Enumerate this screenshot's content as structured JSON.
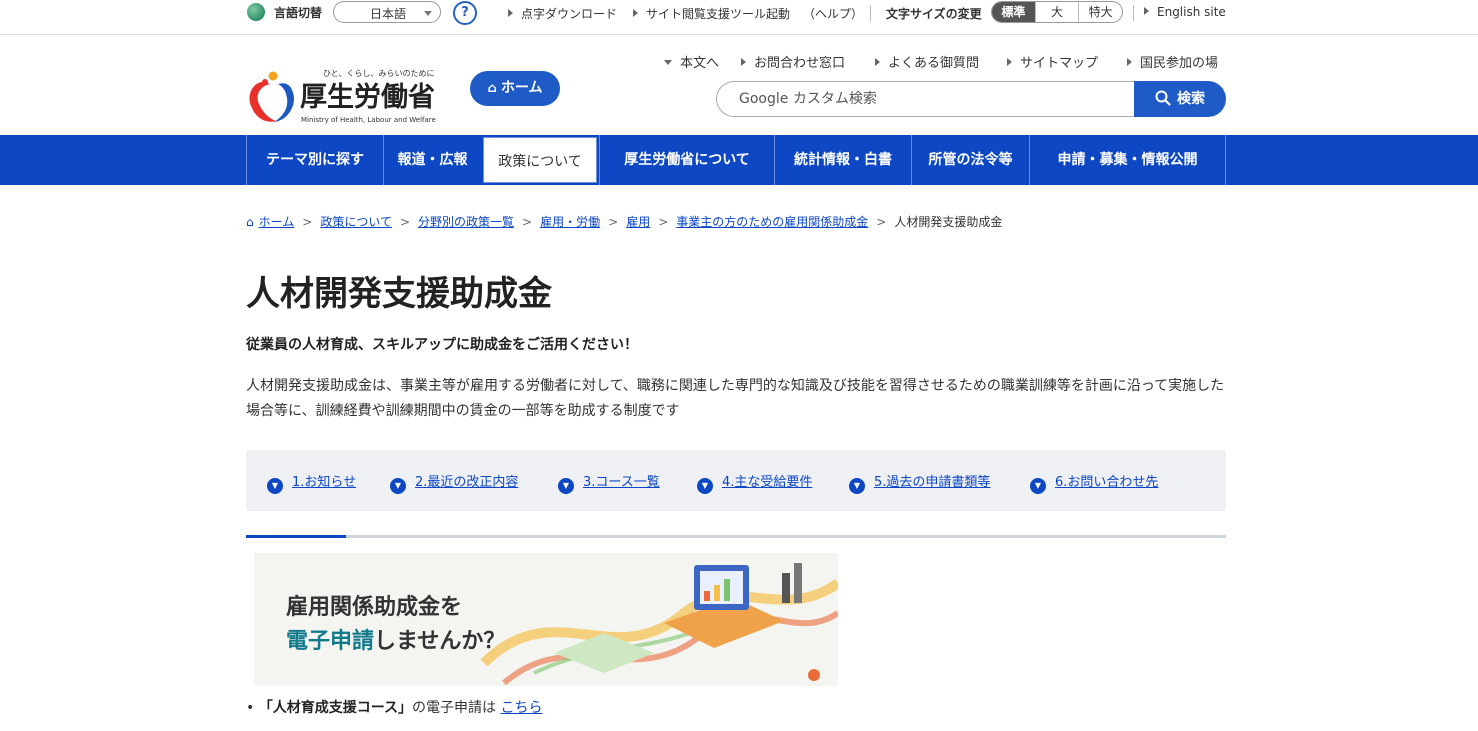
{
  "utility": {
    "lang_label": "言語切替",
    "lang_value": "日本語",
    "help": "?",
    "braille": "点字ダウンロード",
    "reading_tool": "サイト閲覧支援ツール起動",
    "reading_help": "（ヘルプ）",
    "font_size_label": "文字サイズの変更",
    "font_sizes": [
      "標準",
      "大",
      "特大"
    ],
    "english": "English site"
  },
  "header": {
    "logo_tagline": "ひと、くらし、みらいのために",
    "logo_name": "厚生労働省",
    "logo_english": "Ministry of Health, Labour and Welfare",
    "home_button": "ホーム",
    "links": [
      "本文へ",
      "お問合わせ窓口",
      "よくある御質問",
      "サイトマップ",
      "国民参加の場"
    ],
    "search_placeholder": "Google カスタム検索",
    "search_button": "検索"
  },
  "nav": [
    "テーマ別に探す",
    "報道・広報",
    "政策について",
    "厚生労働省について",
    "統計情報・白書",
    "所管の法令等",
    "申請・募集・情報公開"
  ],
  "breadcrumb": [
    "ホーム",
    "政策について",
    "分野別の政策一覧",
    "雇用・労働",
    "雇用",
    "事業主の方のための雇用関係助成金",
    "人材開発支援助成金"
  ],
  "page": {
    "title": "人材開発支援助成金",
    "lead": "従業員の人材育成、スキルアップに助成金をご活用ください！",
    "description": "人材開発支援助成金は、事業主等が雇用する労働者に対して、職務に関連した専門的な知識及び技能を習得させるための職業訓練等を計画に沿って実施した場合等に、訓練経費や訓練期間中の賃金の一部等を助成する制度です",
    "anchors": [
      "1.お知らせ",
      "2.最近の改正内容",
      "3.コース一覧",
      "4.主な受給要件",
      "5.過去の申請書類等",
      "6.お問い合わせ先"
    ],
    "banner_line1": "雇用関係助成金を",
    "banner_line2_highlight": "電子申請",
    "banner_line2_rest": "しませんか？",
    "bullet_bold": "「人材育成支援コース」",
    "bullet_text": "の電子申請は",
    "bullet_link": "こちら"
  },
  "colors": {
    "primary": "#0d47c4",
    "button": "#1e5bc6",
    "anchor_bg": "#eef0f4"
  }
}
